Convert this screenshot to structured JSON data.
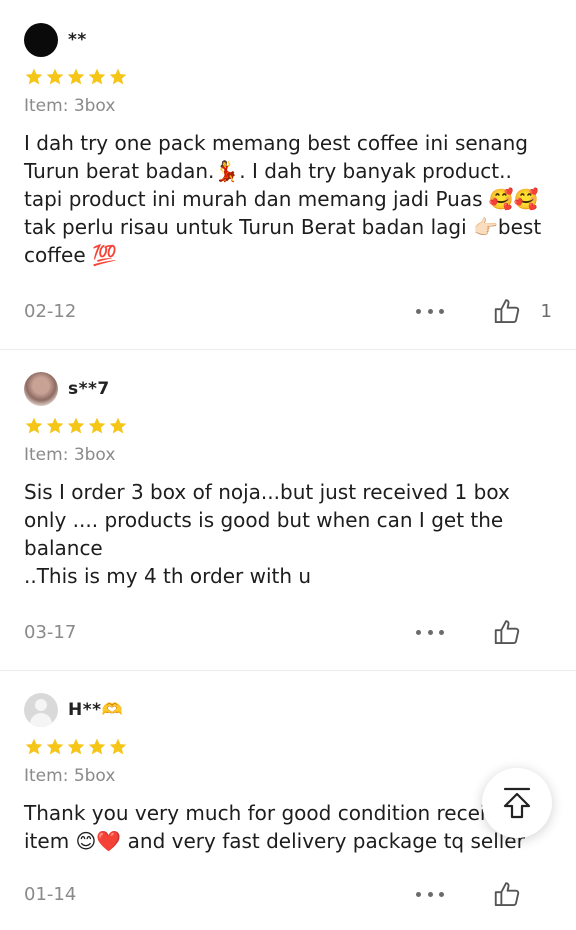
{
  "reviews": [
    {
      "username": "**",
      "avatar": "dark-avatar",
      "rating": 5,
      "item": "Item: 3box",
      "text": "I dah try one pack memang best coffee ini senang\nTurun berat badan.💃. I dah try banyak product..\ntapi product ini murah  dan memang jadi Puas 🥰🥰\ntak perlu risau untuk Turun Berat badan lagi 👉🏻best\ncoffee 💯",
      "date": "02-12",
      "likes": "1"
    },
    {
      "username": "s**7",
      "avatar": "photo-avatar",
      "rating": 5,
      "item": "Item: 3box",
      "text": "Sis I order 3 box of noja...but just received 1 box\nonly .... products is good but when can I get the\nbalance\n..This is my 4 th order with u",
      "date": "03-17",
      "likes": ""
    },
    {
      "username": "H**🫶",
      "avatar": "default-avatar",
      "rating": 5,
      "item": "Item: 5box",
      "text": "Thank you very much for good condition recei\nitem 😊❤️ and very fast delivery package tq seller",
      "date": "01-14",
      "likes": ""
    }
  ],
  "icons": {
    "star": "star-icon",
    "more": "more-dots-icon",
    "like": "thumbs-up-icon",
    "back_to_top": "back-to-top-icon"
  },
  "colors": {
    "star": "#f5c518",
    "muted_text": "#8a8a8a",
    "body_text": "#1d1d1d",
    "divider": "#ececec"
  }
}
